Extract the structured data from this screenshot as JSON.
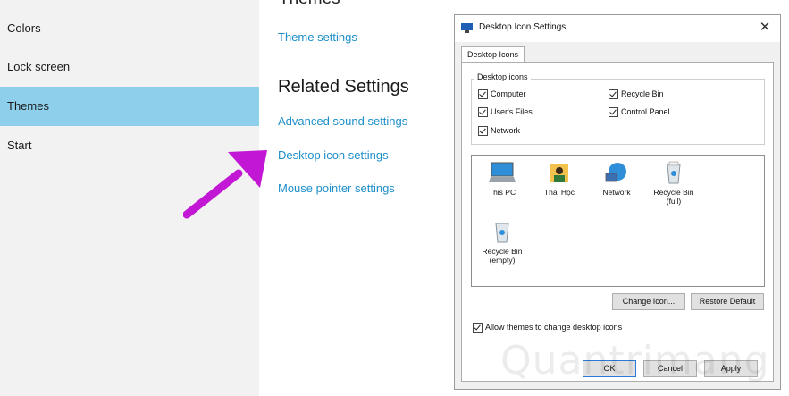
{
  "sidebar": {
    "items": [
      {
        "label": "Colors"
      },
      {
        "label": "Lock screen"
      },
      {
        "label": "Themes",
        "active": true
      },
      {
        "label": "Start"
      }
    ]
  },
  "main": {
    "theme_settings": "Theme settings",
    "related_heading": "Related Settings",
    "links": [
      {
        "label": "Advanced sound settings"
      },
      {
        "label": "Desktop icon settings"
      },
      {
        "label": "Mouse pointer settings"
      }
    ]
  },
  "annotation": {
    "arrow_color": "#c218d6"
  },
  "dialog": {
    "title": "Desktop Icon Settings",
    "close": "✕",
    "tab": "Desktop Icons",
    "group_label": "Desktop icons",
    "checkboxes": [
      {
        "label": "Computer",
        "checked": true
      },
      {
        "label": "Recycle Bin",
        "checked": true
      },
      {
        "label": "User's Files",
        "checked": true
      },
      {
        "label": "Control Panel",
        "checked": true
      },
      {
        "label": "Network",
        "checked": true
      }
    ],
    "icons": [
      {
        "label": "This PC",
        "icon": "computer-icon"
      },
      {
        "label": "Thái Học",
        "icon": "user-folder-icon"
      },
      {
        "label": "Network",
        "icon": "network-icon"
      },
      {
        "label": "Recycle Bin (full)",
        "icon": "recycle-bin-full-icon"
      },
      {
        "label": "Recycle Bin (empty)",
        "icon": "recycle-bin-empty-icon"
      }
    ],
    "change_icon": "Change Icon...",
    "restore_default": "Restore Default",
    "allow_themes": "Allow themes to change desktop icons",
    "ok": "OK",
    "cancel": "Cancel",
    "apply": "Apply"
  },
  "watermark": "Quantrimang"
}
